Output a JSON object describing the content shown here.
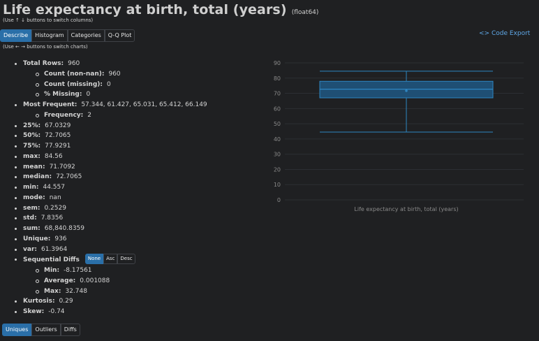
{
  "header": {
    "title": "Life expectancy at birth, total (years)",
    "dtype": "(float64)",
    "hint_columns": "(Use ↑ ↓ buttons to switch columns)",
    "hint_charts": "(Use ← → buttons to switch charts)"
  },
  "tabs": [
    "Describe",
    "Histogram",
    "Categories",
    "Q-Q Plot"
  ],
  "code_export": "<> Code Export",
  "stats": {
    "total_rows": {
      "label": "Total Rows:",
      "value": "960"
    },
    "count_non_nan": {
      "label": "Count (non-nan):",
      "value": "960"
    },
    "count_missing": {
      "label": "Count (missing):",
      "value": "0"
    },
    "pct_missing": {
      "label": "% Missing:",
      "value": "0"
    },
    "most_frequent": {
      "label": "Most Frequent:",
      "value": "57.344, 61.427, 65.031, 65.412, 66.149"
    },
    "frequency": {
      "label": "Frequency:",
      "value": "2"
    },
    "p25": {
      "label": "25%:",
      "value": "67.0329"
    },
    "p50": {
      "label": "50%:",
      "value": "72.7065"
    },
    "p75": {
      "label": "75%:",
      "value": "77.9291"
    },
    "max": {
      "label": "max:",
      "value": "84.56"
    },
    "mean": {
      "label": "mean:",
      "value": "71.7092"
    },
    "median": {
      "label": "median:",
      "value": "72.7065"
    },
    "min": {
      "label": "min:",
      "value": "44.557"
    },
    "mode": {
      "label": "mode:",
      "value": "nan"
    },
    "sem": {
      "label": "sem:",
      "value": "0.2529"
    },
    "std": {
      "label": "std:",
      "value": "7.8356"
    },
    "sum": {
      "label": "sum:",
      "value": "68,840.8359"
    },
    "unique": {
      "label": "Unique:",
      "value": "936"
    },
    "var": {
      "label": "var:",
      "value": "61.3964"
    },
    "sequential_diffs": {
      "label": "Sequential Diffs"
    },
    "seq_min": {
      "label": "Min:",
      "value": "-8.17561"
    },
    "seq_average": {
      "label": "Average:",
      "value": "0.001088"
    },
    "seq_max": {
      "label": "Max:",
      "value": "32.748"
    },
    "kurtosis": {
      "label": "Kurtosis:",
      "value": "0.29"
    },
    "skew": {
      "label": "Skew:",
      "value": "-0.74"
    }
  },
  "seq_sort_buttons": [
    "None",
    "Asc",
    "Desc"
  ],
  "bottom_tabs": [
    "Uniques",
    "Outliers",
    "Diffs"
  ],
  "chart_data": {
    "type": "box",
    "xlabel": "Life expectancy at birth, total (years)",
    "ylim": [
      0,
      90
    ],
    "yticks": [
      0,
      10,
      20,
      30,
      40,
      50,
      60,
      70,
      80,
      90
    ],
    "whisker_low": 44.557,
    "q1": 67.0329,
    "median": 72.7065,
    "q3": 77.9291,
    "whisker_high": 84.56,
    "mean": 71.7092,
    "colors": {
      "box_fill": "#1f4f74",
      "box_stroke": "#2e86c1",
      "grid": "#2c2f33",
      "tick": "#8a8a8a"
    }
  }
}
